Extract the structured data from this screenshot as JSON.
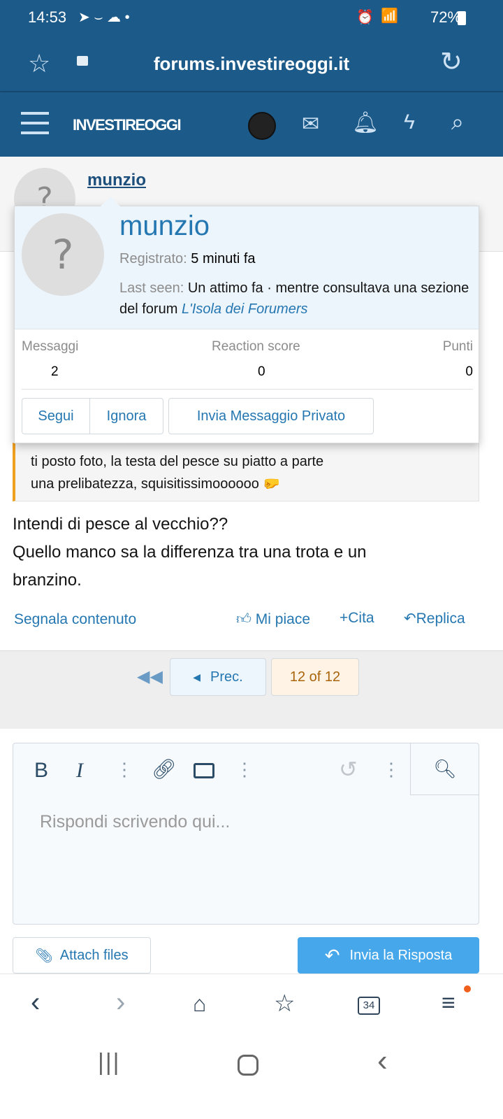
{
  "status_bar": {
    "time": "14:53",
    "battery": "72%",
    "icons": [
      "telegram-icon",
      "amazon-icon",
      "cloud-sync-icon",
      "dot-icon",
      "alarm-icon",
      "wifi-icon",
      "signal-icon",
      "battery-icon"
    ]
  },
  "browser": {
    "url": "forums.investireoggi.it"
  },
  "forum_header": {
    "logo": "INVESTIREOGGI"
  },
  "member": {
    "name": "munzio"
  },
  "popup": {
    "name": "munzio",
    "registered_label": "Registrato:",
    "registered_value": "5 minuti fa",
    "last_seen_label": "Last seen:",
    "last_seen_value": "Un attimo fa · mentre consultava una sezione del forum ",
    "last_seen_link": "L'Isola dei Forumers",
    "stats": [
      {
        "label": "Messaggi",
        "value": "2"
      },
      {
        "label": "Reaction score",
        "value": "0"
      },
      {
        "label": "Punti",
        "value": "0"
      }
    ],
    "buttons": {
      "follow": "Segui",
      "ignore": "Ignora",
      "message": "Invia Messaggio Privato"
    }
  },
  "quote": {
    "line1": "ti posto foto, la testa del pesce su piatto a parte",
    "line2": "una prelibatezza, squisitissimoooooo"
  },
  "post": {
    "line1": "Intendi di pesce al vecchio??",
    "line2": "Quello manco sa la differenza tra una trota e un",
    "line3": "branzino."
  },
  "actions": {
    "report": "Segnala contenuto",
    "like": "Mi piace",
    "quote": "Cita",
    "reply": "Replica"
  },
  "pagination": {
    "prev": "Prec.",
    "current": "12 of 12"
  },
  "editor": {
    "placeholder": "Rispondi scrivendo qui...",
    "bold": "B",
    "italic": "I"
  },
  "footer": {
    "attach": "Attach files",
    "submit": "Invia la Risposta"
  },
  "bottom_nav": {
    "tabs_count": "34"
  },
  "colors": {
    "header": "#1c5a89",
    "link": "#2577b1",
    "accent_orange": "#f0a020",
    "submit": "#47a7eb"
  }
}
